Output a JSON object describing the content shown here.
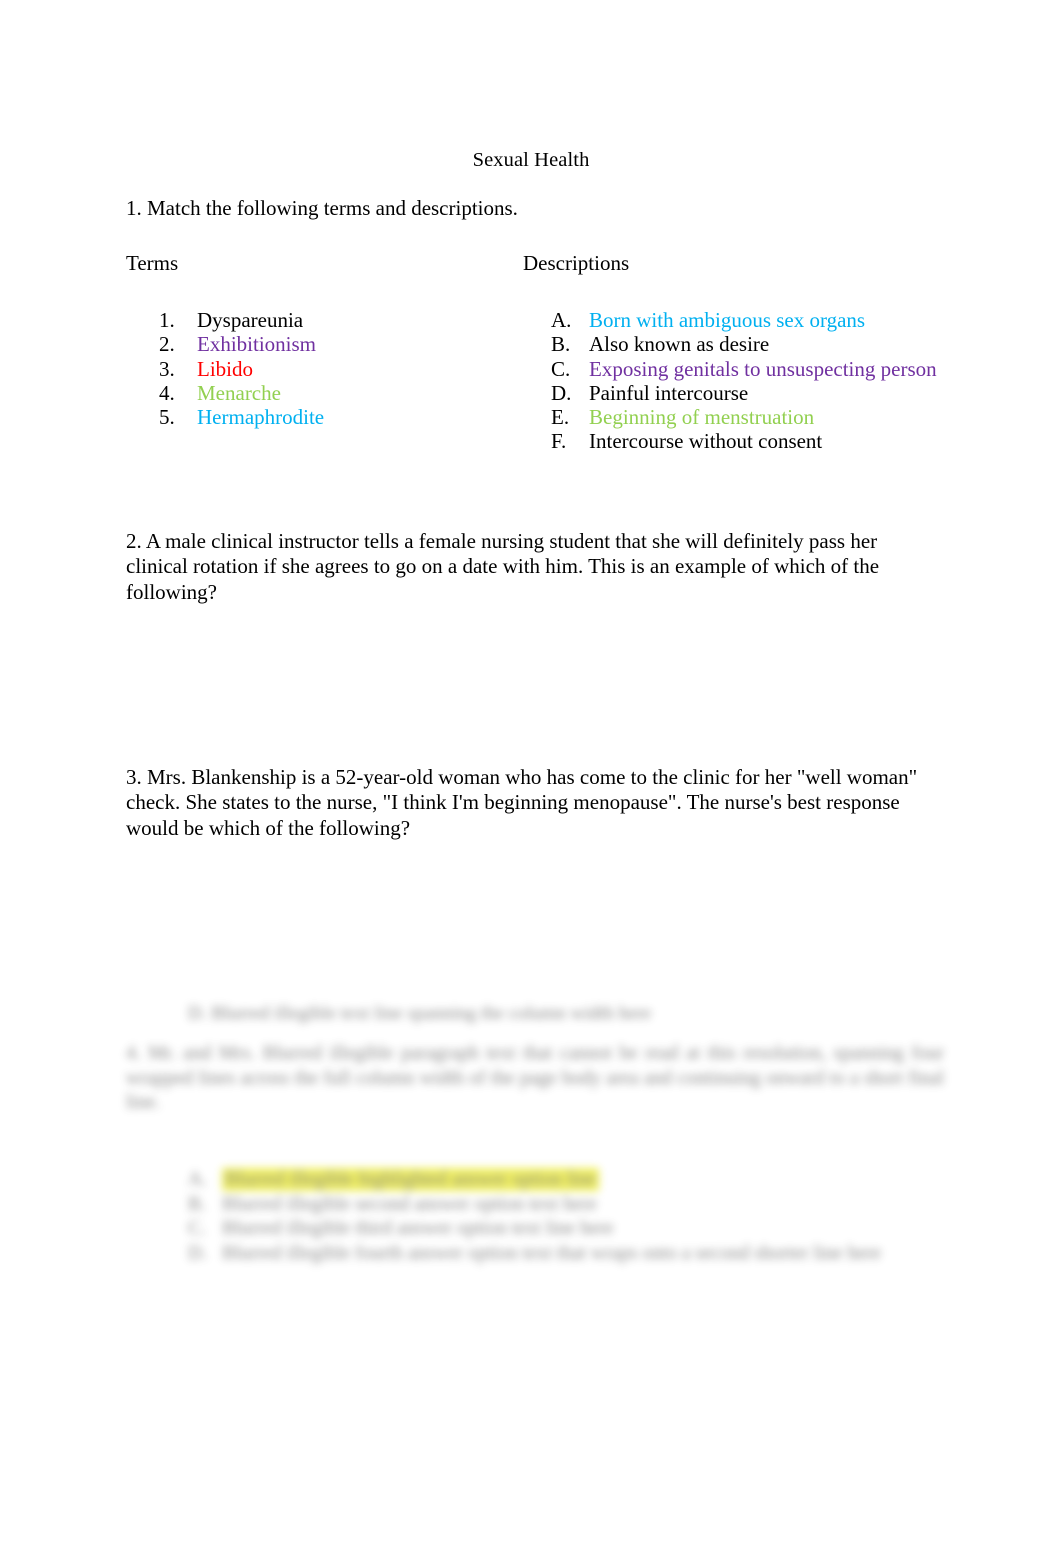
{
  "document": {
    "title": "Sexual Health",
    "background_color": "#ffffff",
    "text_color": "#000000"
  },
  "palette": {
    "black": "#000000",
    "purple": "#7030a0",
    "red": "#ff0000",
    "green": "#92d050",
    "cyan": "#00b0f0",
    "highlight_yellow": "#e9e800"
  },
  "question1": {
    "prompt": "1. Match the following terms and descriptions.",
    "terms_header": "Terms",
    "descriptions_header": "Descriptions",
    "terms": [
      {
        "marker": "1.",
        "text": "Dyspareunia",
        "color": "#000000"
      },
      {
        "marker": "2.",
        "text": "Exhibitionism",
        "color": "#7030a0"
      },
      {
        "marker": "3.",
        "text": "Libido",
        "color": "#ff0000"
      },
      {
        "marker": "4.",
        "text": "Menarche",
        "color": "#92d050"
      },
      {
        "marker": "5.",
        "text": "Hermaphrodite",
        "color": "#00b0f0"
      }
    ],
    "descriptions": [
      {
        "marker": "A.",
        "text": "Born with ambiguous sex organs",
        "color": "#00b0f0"
      },
      {
        "marker": "B.",
        "text": "Also known as desire",
        "color": "#000000"
      },
      {
        "marker": "C.",
        "text": "Exposing genitals to unsuspecting person",
        "color": "#7030a0"
      },
      {
        "marker": "D.",
        "text": "Painful intercourse",
        "color": "#000000"
      },
      {
        "marker": "E.",
        "text": "Beginning of menstruation",
        "color": "#92d050"
      },
      {
        "marker": "F.",
        "text": "Intercourse without consent",
        "color": "#000000"
      }
    ]
  },
  "question2": {
    "text": "2. A male clinical instructor tells a female nursing student that she will definitely pass her clinical rotation if she agrees to go on a date with him. This is an example of which of the following?"
  },
  "question3": {
    "text": "3. Mrs. Blankenship is a 52-year-old woman who has come to the clinic for her \"well woman\" check. She states to the nurse, \"I think I'm beginning menopause\". The nurse's best response would be which of the following?"
  },
  "blurred_section": {
    "note": "illegible",
    "heading": "D. Blurred illegible text line spanning the column width here",
    "paragraph": "4. Mr. and Mrs. Blurred illegible paragraph text that cannot be read at this resolution, spanning four wrapped lines across the full column width of the page body area and continuing onward to a short final line.",
    "options": [
      {
        "marker": "A.",
        "text": "Blurred illegible highlighted answer option line",
        "highlighted": true
      },
      {
        "marker": "B.",
        "text": "Blurred illegible second answer option text here",
        "highlighted": false
      },
      {
        "marker": "C.",
        "text": "Blurred illegible third answer option text line here",
        "highlighted": false
      },
      {
        "marker": "D.",
        "text": "Blurred illegible fourth answer option text that wraps onto a second shorter line here",
        "highlighted": false
      }
    ]
  }
}
